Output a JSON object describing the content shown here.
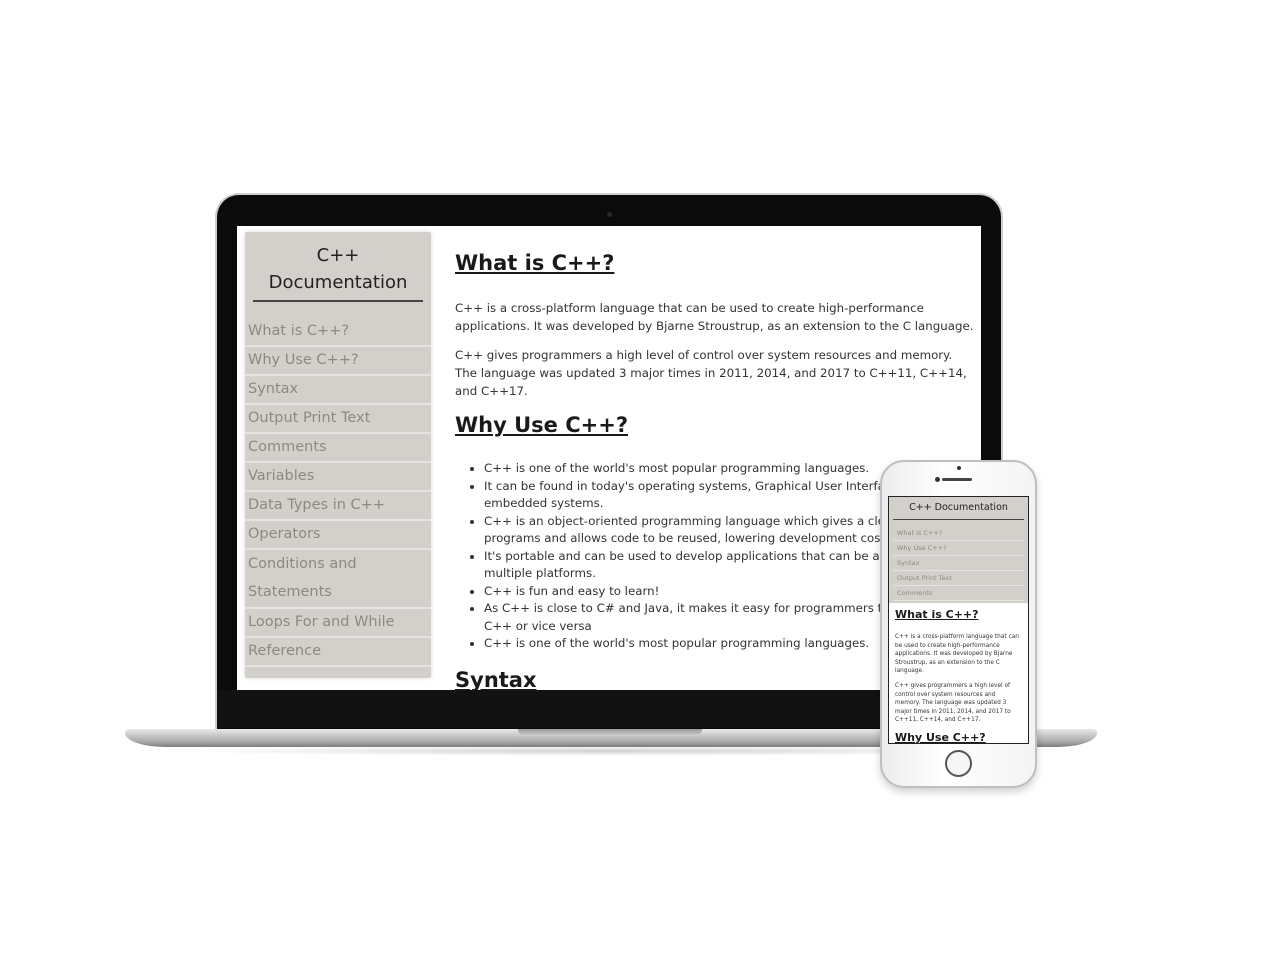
{
  "laptop": {
    "nav": {
      "title": "C++\nDocumentation",
      "items": [
        {
          "label": "What is C++?"
        },
        {
          "label": "Why Use C++?"
        },
        {
          "label": "Syntax"
        },
        {
          "label": "Output Print Text"
        },
        {
          "label": "Comments"
        },
        {
          "label": "Variables"
        },
        {
          "label": "Data Types in C++"
        },
        {
          "label": "Operators"
        },
        {
          "label": "Conditions and Statements"
        },
        {
          "label": "Loops For and While"
        },
        {
          "label": "Reference"
        }
      ]
    },
    "main": {
      "section1_title": "What is C++?",
      "section1_p1": "C++ is a cross-platform language that can be used to create high-performance applications. It was developed by Bjarne Stroustrup, as an extension to the C language.",
      "section1_p2": "C++ gives programmers a high level of control over system resources and memory. The language was updated 3 major times in 2011, 2014, and 2017 to C++11, C++14, and C++17.",
      "section2_title": "Why Use C++?",
      "section2_list": [
        "C++ is one of the world's most popular programming languages.",
        "It can be found in today's operating systems, Graphical User Interfaces, and embedded systems.",
        "C++ is an object-oriented programming language which gives a clear structure to programs and allows code to be reused, lowering development costs.",
        "It's portable and can be used to develop applications that can be adapted to multiple platforms.",
        "C++ is fun and easy to learn!",
        "As C++ is close to C# and Java, it makes it easy for programmers to switch to C++ or vice versa",
        "C++ is one of the world's most popular programming languages."
      ],
      "section3_title": "Syntax"
    }
  },
  "phone": {
    "nav": {
      "title": "C++ Documentation",
      "items": [
        {
          "label": "What is C++?"
        },
        {
          "label": "Why Use C++?"
        },
        {
          "label": "Syntax"
        },
        {
          "label": "Output Print Text"
        },
        {
          "label": "Comments"
        }
      ]
    },
    "main": {
      "section1_title": "What is C++?",
      "section1_p1": "C++ is a cross-platform language that can be used to create high-performance applications. It was developed by Bjarne Stroustrup, as an extension to the C language.",
      "section1_p2": "C++ gives programmers a high level of control over system resources and memory. The language was updated 3 major times in 2011, 2014, and 2017 to C++11, C++14, and C++17.",
      "section2_title": "Why Use C++?"
    }
  }
}
